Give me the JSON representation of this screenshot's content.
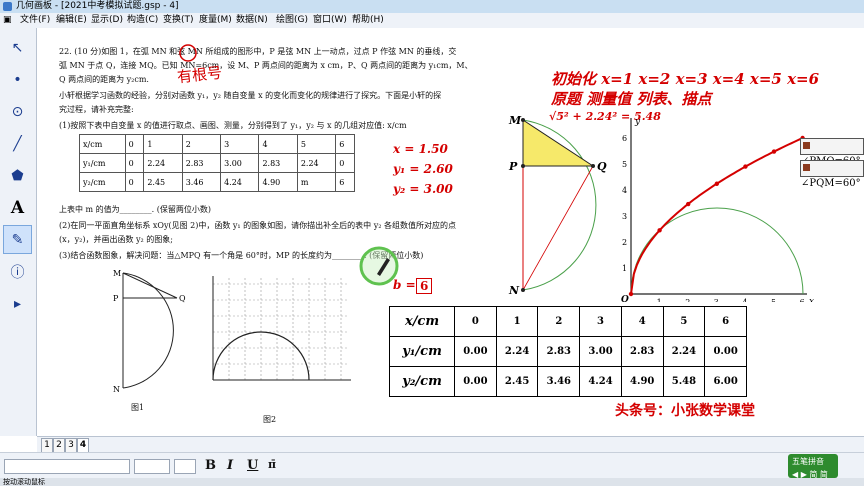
{
  "titlebar": {
    "title": "几何画板 - [2021中考模拟试题.gsp - 4]"
  },
  "menu": [
    "文件(F)",
    "编辑(E)",
    "显示(D)",
    "构造(C)",
    "变换(T)",
    "度量(M)",
    "数据(N)",
    "绘图(G)",
    "窗口(W)",
    "帮助(H)"
  ],
  "tools": [
    {
      "name": "arrow-tool",
      "glyph": "↖"
    },
    {
      "name": "point-tool",
      "glyph": "•"
    },
    {
      "name": "compass-tool",
      "glyph": "⊙"
    },
    {
      "name": "line-tool",
      "glyph": "╱"
    },
    {
      "name": "polygon-tool",
      "glyph": "⬟"
    },
    {
      "name": "text-tool",
      "glyph": "A"
    },
    {
      "name": "marker-tool",
      "glyph": "✎"
    },
    {
      "name": "information-tool",
      "glyph": "ⓘ"
    },
    {
      "name": "custom-tool",
      "glyph": "▸"
    }
  ],
  "problem": {
    "line1": "22. (10 分)如图 1，在弧 MN 和弦 MN 所组成的图形中，P 是弦 MN 上一动点，过点 P 作弦 MN 的垂线，交",
    "line2": "弧 MN 于点 Q，连接 MQ。已知 MN=6cm，设 M、P 两点间的距离为 x cm，P、Q 两点间的距离为 y₁cm，M、",
    "line3": "Q 两点间的距离为 y₂cm.",
    "line4": "小轩根据学习函数的经验，分别对函数 y₁，y₂ 随自变量 x 的变化而变化的规律进行了探究。下面是小轩的探",
    "line5": "究过程，请补充完整:",
    "line6": "(1)按照下表中自变量 x 的值进行取点、画图、测量，分别得到了 y₁，y₂ 与 x 的几组对应值: x/cm",
    "m_line": "上表中 m 的值为________. (保留两位小数)",
    "q2_line1": "(2)在同一平面直角坐标系 xOy(见图 2)中，函数 y₁ 的图象如图，请你描出补全后的表中 y₂ 各组数值所对应的点",
    "q2_line2": "(x，y₂)，并画出函数 y₂ 的图象;",
    "q3_line": "(3)结合函数图象，解决问题：当△MPQ 有一个角是 60°时，MP 的长度约为________. (保留两位小数)",
    "fig1": "图1",
    "fig2": "图2",
    "handwritten": "有根号"
  },
  "small_table": {
    "rows": [
      [
        "x/cm",
        "0",
        "1",
        "2",
        "3",
        "4",
        "5",
        "6"
      ],
      [
        "y₁/cm",
        "0",
        "2.24",
        "2.83",
        "3.00",
        "2.83",
        "2.24",
        "0"
      ],
      [
        "y₂/cm",
        "0",
        "2.45",
        "3.46",
        "4.24",
        "4.90",
        "m",
        "6"
      ]
    ]
  },
  "measurements": {
    "x": "x = 1.50",
    "y1": "y₁ = 2.60",
    "y2": "y₂ = 3.00",
    "b_label": "b =",
    "b_value": "6"
  },
  "notes": {
    "line1": "初始化 x=1 x=2 x=3 x=4 x=5 x=6",
    "line2": "原题    测量值   列表、描点",
    "sqrt": "√5² + 2.24² = 5.48",
    "brand": "头条号：小张数学课堂"
  },
  "angles": {
    "pmq": "∠PMQ=60°",
    "pqm": "∠PQM=60°"
  },
  "geometry_labels": {
    "M": "M",
    "P": "P",
    "Q": "Q",
    "N": "N"
  },
  "graph": {
    "x_axis": "x",
    "y_axis": "y",
    "origin": "O",
    "x_ticks": [
      "1",
      "2",
      "3",
      "4",
      "5",
      "6"
    ],
    "y_ticks": [
      "1",
      "2",
      "3",
      "4",
      "5",
      "6"
    ]
  },
  "big_table": {
    "headers": [
      "x/cm",
      "y₁/cm",
      "y₂/cm"
    ],
    "rows": [
      [
        "0",
        "1",
        "2",
        "3",
        "4",
        "5",
        "6"
      ],
      [
        "0.00",
        "2.24",
        "2.83",
        "3.00",
        "2.83",
        "2.24",
        "0.00"
      ],
      [
        "0.00",
        "2.45",
        "3.46",
        "4.24",
        "4.90",
        "5.48",
        "6.00"
      ]
    ]
  },
  "page_tabs": [
    "1",
    "2",
    "3",
    "4"
  ],
  "active_page": "4",
  "format": {
    "bold": "B",
    "italic": "I",
    "underline": "U"
  },
  "ime": {
    "title": "五笔拼音",
    "row2": "◀ ▶ 简 简"
  },
  "status": "按动滚动鼠标"
}
